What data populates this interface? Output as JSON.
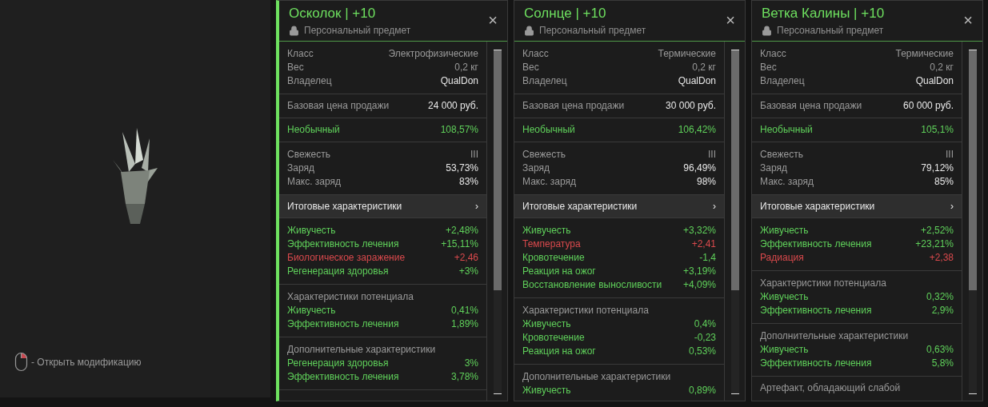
{
  "viewer": {
    "hint": "- Открыть модификацию"
  },
  "panels": [
    {
      "selected": true,
      "title": "Осколок | +10",
      "subtitle": "Персональный предмет",
      "close": "×",
      "info": [
        {
          "label": "Класс",
          "value": "Электрофизические",
          "kind": "muted"
        },
        {
          "label": "Вес",
          "value": "0,2 кг",
          "kind": "muted"
        },
        {
          "label": "Владелец",
          "value": "QualDon",
          "kind": "bright"
        }
      ],
      "price": {
        "label": "Базовая цена продажи",
        "value": "24 000 руб."
      },
      "rarity": {
        "label": "Необычный",
        "value": "108,57%"
      },
      "condition": [
        {
          "label": "Свежесть",
          "value": "III",
          "kind": "muted"
        },
        {
          "label": "Заряд",
          "value": "53,73%",
          "kind": "bright"
        },
        {
          "label": "Макс. заряд",
          "value": "83%",
          "kind": "bright"
        }
      ],
      "summary": {
        "label": "Итоговые характеристики",
        "arrow": "›"
      },
      "stats": [
        {
          "label": "Живучесть",
          "value": "+2,48%",
          "kind": "good"
        },
        {
          "label": "Эффективность лечения",
          "value": "+15,11%",
          "kind": "good"
        },
        {
          "label": "Биологическое заражение",
          "value": "+2,46",
          "kind": "bad"
        },
        {
          "label": "Регенерация здоровья",
          "value": "+3%",
          "kind": "good"
        }
      ],
      "potential": {
        "title": "Характеристики потенциала",
        "stats": [
          {
            "label": "Живучесть",
            "value": "0,41%",
            "kind": "good"
          },
          {
            "label": "Эффективность лечения",
            "value": "1,89%",
            "kind": "good"
          }
        ]
      },
      "extra": {
        "title": "Дополнительные характеристики",
        "stats": [
          {
            "label": "Регенерация здоровья",
            "value": "3%",
            "kind": "good"
          },
          {
            "label": "Эффективность лечения",
            "value": "3,78%",
            "kind": "good"
          }
        ]
      }
    },
    {
      "selected": false,
      "title": "Солнце | +10",
      "subtitle": "Персональный предмет",
      "close": "×",
      "info": [
        {
          "label": "Класс",
          "value": "Термические",
          "kind": "muted"
        },
        {
          "label": "Вес",
          "value": "0,2 кг",
          "kind": "muted"
        },
        {
          "label": "Владелец",
          "value": "QualDon",
          "kind": "bright"
        }
      ],
      "price": {
        "label": "Базовая цена продажи",
        "value": "30 000 руб."
      },
      "rarity": {
        "label": "Необычный",
        "value": "106,42%"
      },
      "condition": [
        {
          "label": "Свежесть",
          "value": "III",
          "kind": "muted"
        },
        {
          "label": "Заряд",
          "value": "96,49%",
          "kind": "bright"
        },
        {
          "label": "Макс. заряд",
          "value": "98%",
          "kind": "bright"
        }
      ],
      "summary": {
        "label": "Итоговые характеристики",
        "arrow": "›"
      },
      "stats": [
        {
          "label": "Живучесть",
          "value": "+3,32%",
          "kind": "good"
        },
        {
          "label": "Температура",
          "value": "+2,41",
          "kind": "bad"
        },
        {
          "label": "Кровотечение",
          "value": "-1,4",
          "kind": "good"
        },
        {
          "label": "Реакция на ожог",
          "value": "+3,19%",
          "kind": "good"
        },
        {
          "label": "Восстановление выносливости",
          "value": "+4,09%",
          "kind": "good"
        }
      ],
      "potential": {
        "title": "Характеристики потенциала",
        "stats": [
          {
            "label": "Живучесть",
            "value": "0,4%",
            "kind": "good"
          },
          {
            "label": "Кровотечение",
            "value": "-0,23",
            "kind": "good"
          },
          {
            "label": "Реакция на ожог",
            "value": "0,53%",
            "kind": "good"
          }
        ]
      },
      "extra": {
        "title": "Дополнительные характеристики",
        "stats": [
          {
            "label": "Живучесть",
            "value": "0,89%",
            "kind": "good"
          }
        ]
      }
    },
    {
      "selected": false,
      "title": "Ветка Калины | +10",
      "subtitle": "Персональный предмет",
      "close": "×",
      "info": [
        {
          "label": "Класс",
          "value": "Термические",
          "kind": "muted"
        },
        {
          "label": "Вес",
          "value": "0,2 кг",
          "kind": "muted"
        },
        {
          "label": "Владелец",
          "value": "QualDon",
          "kind": "bright"
        }
      ],
      "price": {
        "label": "Базовая цена продажи",
        "value": "60 000 руб."
      },
      "rarity": {
        "label": "Необычный",
        "value": "105,1%"
      },
      "condition": [
        {
          "label": "Свежесть",
          "value": "III",
          "kind": "muted"
        },
        {
          "label": "Заряд",
          "value": "79,12%",
          "kind": "bright"
        },
        {
          "label": "Макс. заряд",
          "value": "85%",
          "kind": "bright"
        }
      ],
      "summary": {
        "label": "Итоговые характеристики",
        "arrow": "›"
      },
      "stats": [
        {
          "label": "Живучесть",
          "value": "+2,52%",
          "kind": "good"
        },
        {
          "label": "Эффективность лечения",
          "value": "+23,21%",
          "kind": "good"
        },
        {
          "label": "Радиация",
          "value": "+2,38",
          "kind": "bad"
        }
      ],
      "potential": {
        "title": "Характеристики потенциала",
        "stats": [
          {
            "label": "Живучесть",
            "value": "0,32%",
            "kind": "good"
          },
          {
            "label": "Эффективность лечения",
            "value": "2,9%",
            "kind": "good"
          }
        ]
      },
      "extra": {
        "title": "Дополнительные характеристики",
        "stats": [
          {
            "label": "Живучесть",
            "value": "0,63%",
            "kind": "good"
          },
          {
            "label": "Эффективность лечения",
            "value": "5,8%",
            "kind": "good"
          }
        ]
      },
      "description": "Артефакт, обладающий слабой"
    }
  ]
}
